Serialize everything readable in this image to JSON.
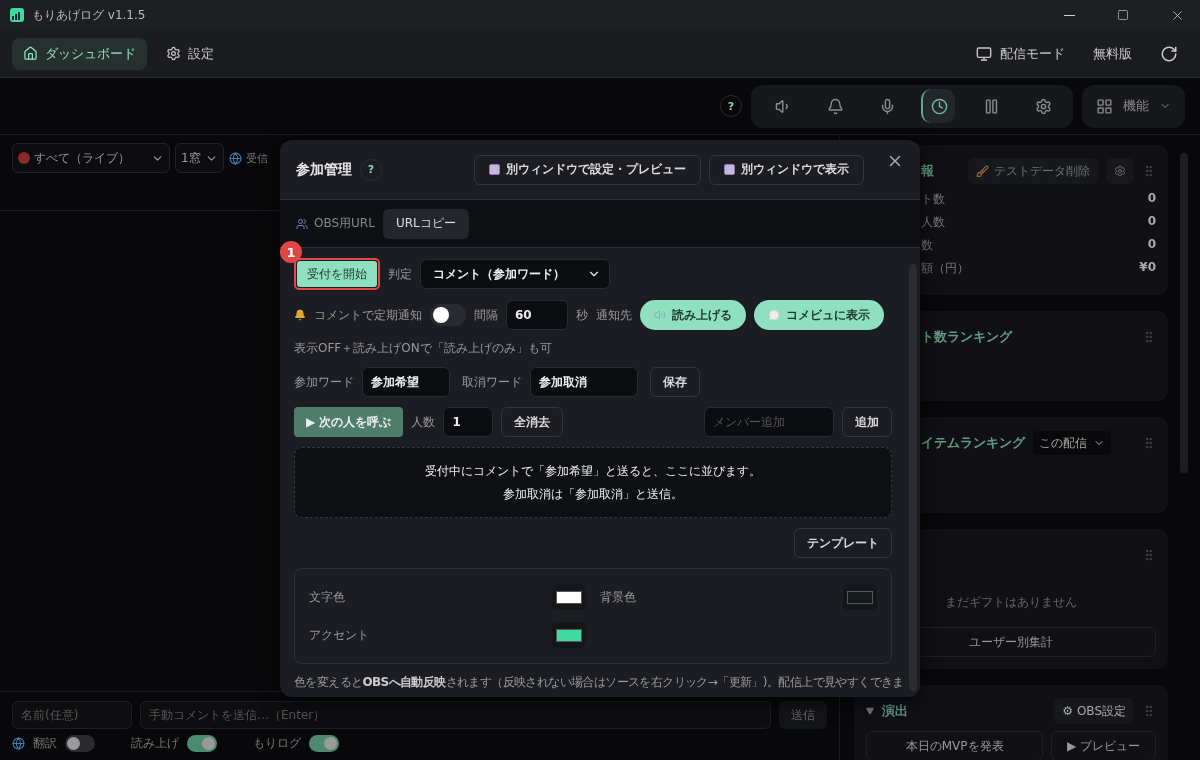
{
  "titlebar": {
    "title": "もりあげログ v1.1.5"
  },
  "nav": {
    "tabs": [
      {
        "label": "ダッシュボード",
        "selected": true
      },
      {
        "label": "設定",
        "selected": false
      }
    ],
    "stream_mode": "配信モード",
    "plan": "無料版"
  },
  "toolbar": {
    "help": "?",
    "tools": [
      {
        "kind": "speaker",
        "selected": false
      },
      {
        "kind": "bell",
        "selected": false
      },
      {
        "kind": "mic",
        "selected": false
      },
      {
        "kind": "clock",
        "selected": true
      },
      {
        "kind": "pause",
        "selected": false
      },
      {
        "kind": "gear",
        "selected": false
      }
    ],
    "features": "機能"
  },
  "filters": {
    "source": "すべて（ライブ）",
    "windows": "1窓",
    "receive": "受信"
  },
  "composer": {
    "name_placeholder": "名前(任意)",
    "comment_placeholder": "手動コメントを送信…（Enter）",
    "send": "送信",
    "toggles": [
      {
        "label": "翻訳",
        "on": false
      },
      {
        "label": "読み上げ",
        "on": true
      },
      {
        "label": "もりログ",
        "on": true
      }
    ]
  },
  "side_panels": [
    {
      "kind": "stats",
      "title": "報",
      "action": "テストデータ削除",
      "stats": [
        {
          "label": "ト数",
          "value": "0"
        },
        {
          "label": "人数",
          "value": "0"
        },
        {
          "label": "数",
          "value": "0"
        },
        {
          "label": "額（円）",
          "value": "¥0"
        }
      ]
    },
    {
      "kind": "ranking",
      "title": "ト数ランキング"
    },
    {
      "kind": "item_ranking",
      "title": "イテムランキング",
      "select": "この配信"
    },
    {
      "kind": "gifts",
      "message": "まだギフトはありません",
      "button": "ユーザー別集計"
    },
    {
      "kind": "effects",
      "title": "演出",
      "action": "⚙ OBS設定",
      "buttons": [
        "本日のMVPを発表",
        "▶ プレビュー"
      ]
    }
  ],
  "modal": {
    "title": "参加管理",
    "help": "?",
    "header_buttons": [
      "別ウィンドウで設定・プレビュー",
      "別ウィンドウで表示"
    ],
    "obs_url_label": "OBS用URL",
    "copy_button": "URLコピー",
    "start_button": "受付を開始",
    "annotation": "1",
    "judge_label": "判定",
    "judge_value": "コメント（参加ワード）",
    "notify": {
      "label": "コメントで定期通知",
      "on": false,
      "interval_label": "間隔",
      "interval": "60",
      "unit": "秒",
      "target_label": "通知先",
      "targets": [
        {
          "kind": "speaker",
          "label": "読み上げる",
          "selected": true
        },
        {
          "kind": "bubble",
          "label": "コメビュに表示",
          "selected": true
        }
      ]
    },
    "hint": "表示OFF＋読み上げONで「読み上げのみ」も可",
    "join_word_label": "参加ワード",
    "join_word": "参加希望",
    "cancel_word_label": "取消ワード",
    "cancel_word": "参加取消",
    "save": "保存",
    "call_next": "▶ 次の人を呼ぶ",
    "count_label": "人数",
    "count": "1",
    "clear_all": "全消去",
    "member_placeholder": "メンバー追加",
    "add": "追加",
    "queue_message": [
      "受付中にコメントで「参加希望」と送ると、ここに並びます。",
      "参加取消は「参加取消」と送信。"
    ],
    "template": "テンプレート",
    "colors": [
      {
        "label": "文字色",
        "color": "#ffffff"
      },
      {
        "label": "背景色",
        "color": "#151a1a"
      },
      {
        "label": "アクセント",
        "color": "#3ddc9e"
      }
    ],
    "note": "色を変えると**OBSへ自動反映**されます（反映されない場合はソースを右クリック→「更新」)。配信上で見やすくできま"
  }
}
